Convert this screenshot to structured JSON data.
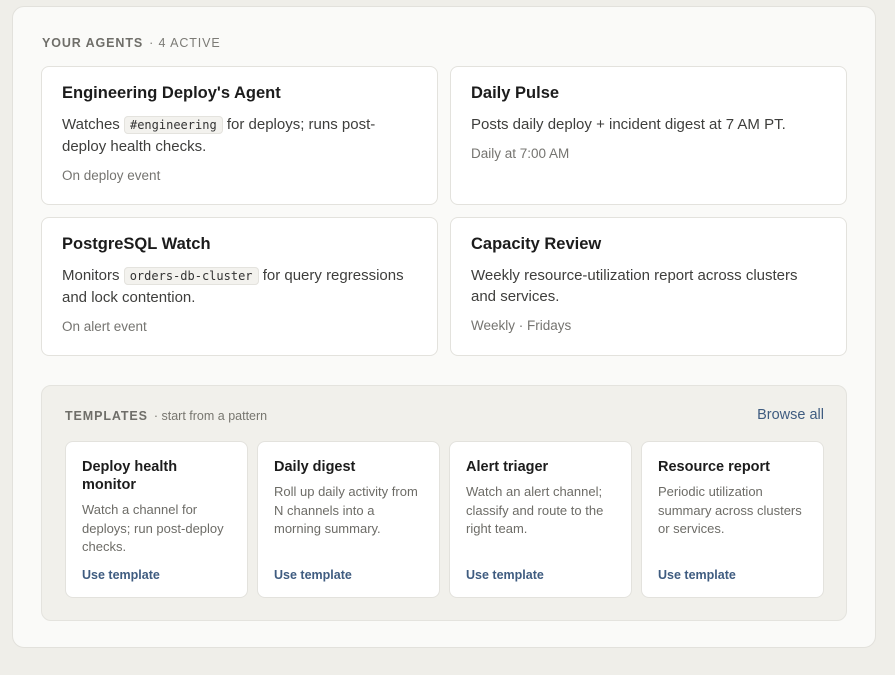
{
  "agents_section": {
    "label": "YOUR AGENTS",
    "count": "· 4 ACTIVE",
    "cards": [
      {
        "title": "Engineering Deploy's Agent",
        "desc_prefix": "Watches",
        "code": "#engineering",
        "desc_suffix": "for deploys; runs post-deploy health checks.",
        "meta": "On deploy event"
      },
      {
        "title": "Daily Pulse",
        "desc": "Posts daily deploy + incident digest at 7 AM PT.",
        "meta": "Daily at 7:00 AM"
      },
      {
        "title": "PostgreSQL Watch",
        "desc_prefix": "Monitors",
        "code": "orders-db-cluster",
        "desc_suffix": "for query regressions and lock contention.",
        "meta": "On alert event"
      },
      {
        "title": "Capacity Review",
        "desc": "Weekly resource-utilization report across clusters and services.",
        "meta": "Weekly · Fridays"
      }
    ]
  },
  "templates_section": {
    "label": "TEMPLATES",
    "subtitle": "· start from a pattern",
    "browse_all": "Browse all",
    "cards": [
      {
        "title": "Deploy health monitor",
        "desc": "Watch a channel for deploys; run post-deploy checks.",
        "link": "Use template"
      },
      {
        "title": "Daily digest",
        "desc": "Roll up daily activity from N channels into a morning summary.",
        "link": "Use template"
      },
      {
        "title": "Alert triager",
        "desc": "Watch an alert channel; classify and route to the right team.",
        "link": "Use template"
      },
      {
        "title": "Resource report",
        "desc": "Periodic utilization summary across clusters or services.",
        "link": "Use template"
      }
    ]
  }
}
